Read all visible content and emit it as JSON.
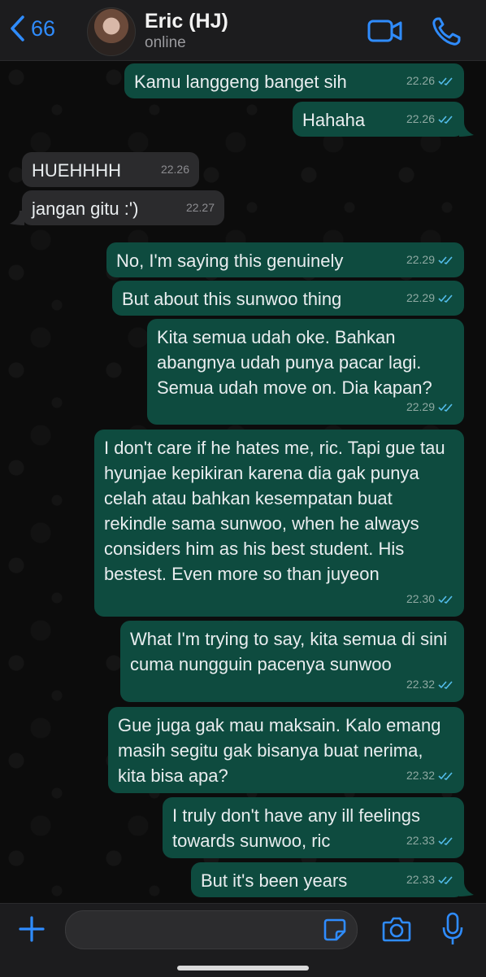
{
  "header": {
    "back_count": "66",
    "contact_name": "Eric (HJ)",
    "contact_status": "online",
    "colors": {
      "accent": "#2f8cff",
      "outgoing": "#0e4b3f",
      "incoming": "#2b2b2d"
    }
  },
  "messages": [
    {
      "text": "Kamu langgeng banget sih",
      "time": "22.26",
      "dir": "out"
    },
    {
      "text": "Hahaha",
      "time": "22.26",
      "dir": "out"
    },
    {
      "text": "HUEHHHH",
      "time": "22.26",
      "dir": "in"
    },
    {
      "text": "jangan gitu :')",
      "time": "22.27",
      "dir": "in"
    },
    {
      "text": "No, I'm saying this genuinely",
      "time": "22.29",
      "dir": "out"
    },
    {
      "text": "But about this sunwoo thing",
      "time": "22.29",
      "dir": "out"
    },
    {
      "text": "Kita semua udah oke. Bahkan abangnya udah punya pacar lagi. Semua udah move on. Dia kapan?",
      "time": "22.29",
      "dir": "out"
    },
    {
      "text": "I don't care if he hates me, ric. Tapi gue tau hyunjae kepikiran karena dia gak punya celah atau bahkan kesempatan buat rekindle sama sunwoo, when he always considers him as his best student. His bestest. Even more so than juyeon",
      "time": "22.30",
      "dir": "out"
    },
    {
      "text": "What I'm trying to say, kita semua di sini cuma nungguin pacenya sunwoo",
      "time": "22.32",
      "dir": "out"
    },
    {
      "text": "Gue juga gak mau maksain. Kalo emang masih segitu gak bisanya buat nerima, kita bisa apa?",
      "time": "22.32",
      "dir": "out"
    },
    {
      "text": "I truly don't have any ill feelings towards sunwoo, ric",
      "time": "22.33",
      "dir": "out"
    },
    {
      "text": "But it's been years",
      "time": "22.33",
      "dir": "out"
    }
  ],
  "icons": {
    "back": "chevron-left-icon",
    "video": "video-camera-icon",
    "call": "phone-icon",
    "plus": "plus-icon",
    "sticker": "sticker-icon",
    "camera": "camera-icon",
    "mic": "microphone-icon",
    "read": "double-check-icon"
  }
}
